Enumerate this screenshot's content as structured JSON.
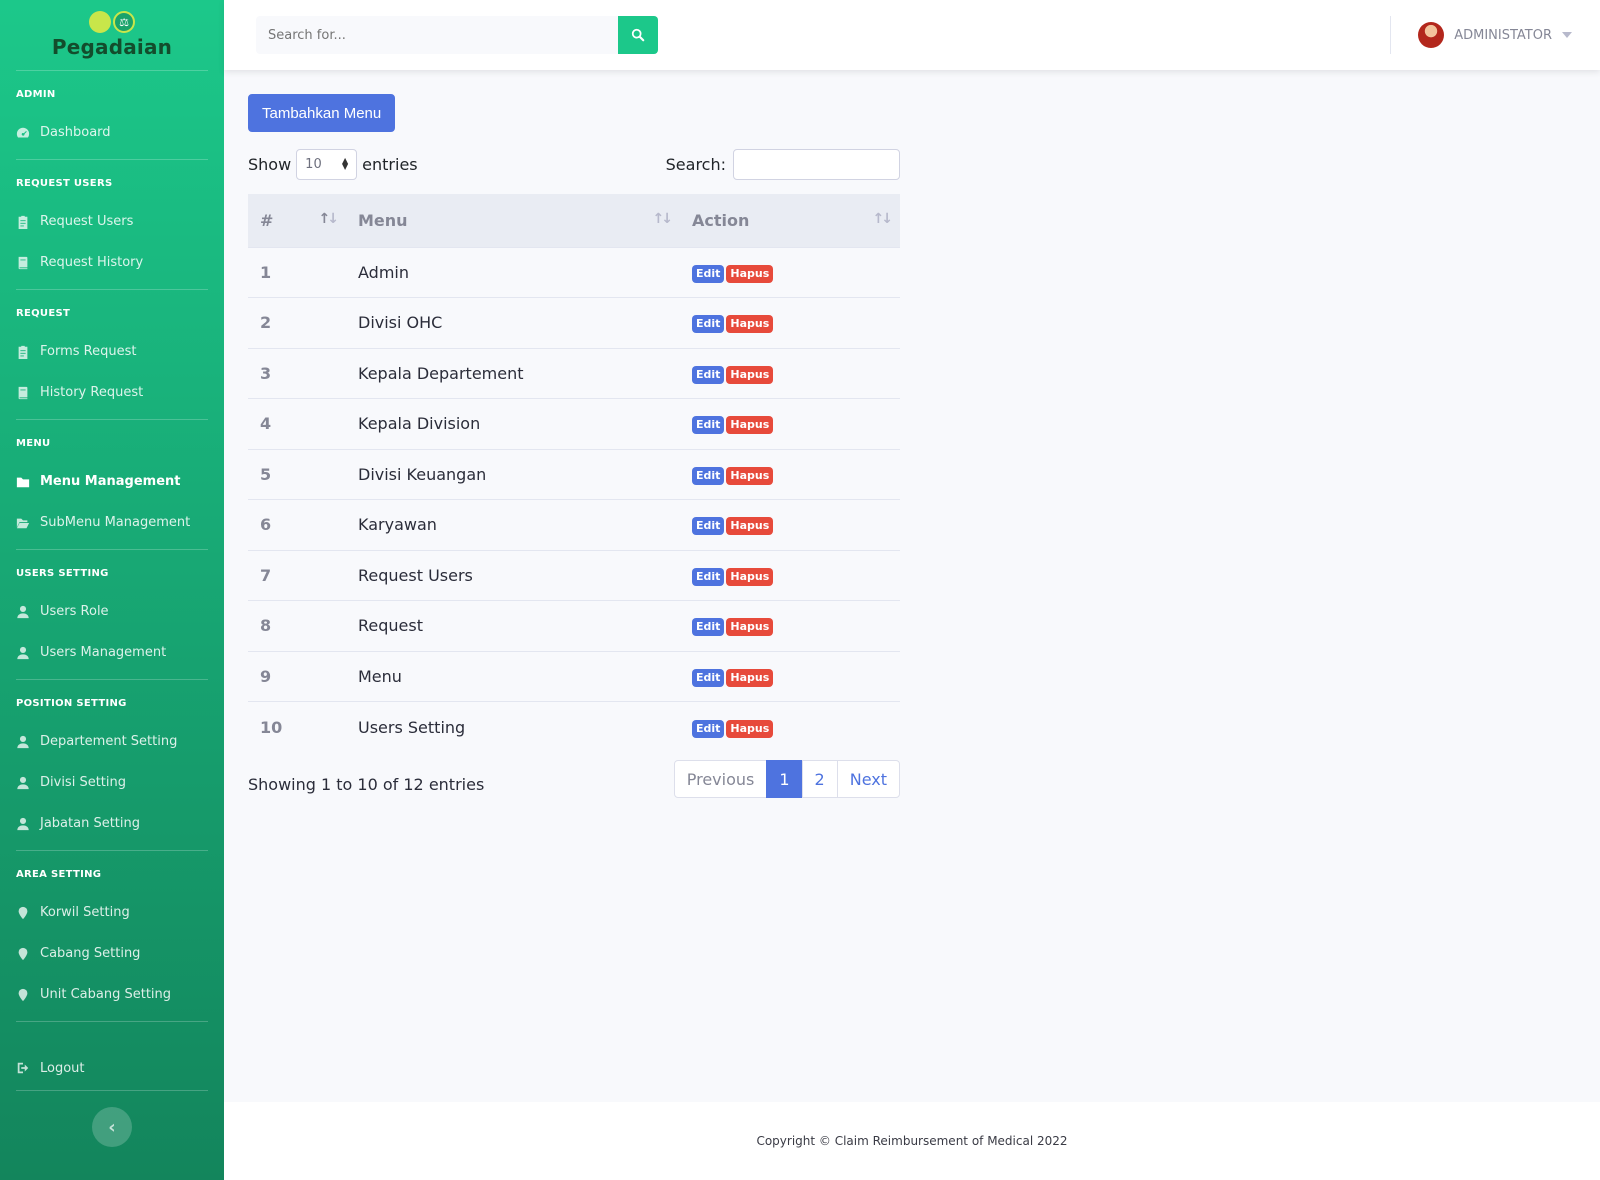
{
  "brand": {
    "name": "Pegadaian"
  },
  "sidebar": {
    "sections": [
      {
        "heading": "ADMIN",
        "items": [
          {
            "label": "Dashboard",
            "icon": "dashboard-icon"
          }
        ]
      },
      {
        "heading": "REQUEST USERS",
        "items": [
          {
            "label": "Request Users",
            "icon": "clipboard-icon"
          },
          {
            "label": "Request History",
            "icon": "book-icon"
          }
        ]
      },
      {
        "heading": "REQUEST",
        "items": [
          {
            "label": "Forms Request",
            "icon": "clipboard-icon"
          },
          {
            "label": "History Request",
            "icon": "book-icon"
          }
        ]
      },
      {
        "heading": "MENU",
        "items": [
          {
            "label": "Menu Management",
            "icon": "folder-icon",
            "active": true
          },
          {
            "label": "SubMenu Management",
            "icon": "folder-open-icon"
          }
        ]
      },
      {
        "heading": "USERS SETTING",
        "items": [
          {
            "label": "Users Role",
            "icon": "user-icon"
          },
          {
            "label": "Users Management",
            "icon": "user-icon"
          }
        ]
      },
      {
        "heading": "POSITION SETTING",
        "items": [
          {
            "label": "Departement Setting",
            "icon": "user-icon"
          },
          {
            "label": "Divisi Setting",
            "icon": "user-icon"
          },
          {
            "label": "Jabatan Setting",
            "icon": "user-icon"
          }
        ]
      },
      {
        "heading": "AREA SETTING",
        "items": [
          {
            "label": "Korwil Setting",
            "icon": "map-marker-icon"
          },
          {
            "label": "Cabang Setting",
            "icon": "map-marker-icon"
          },
          {
            "label": "Unit Cabang Setting",
            "icon": "map-marker-icon"
          }
        ]
      }
    ],
    "logout_label": "Logout",
    "toggle_glyph": "‹"
  },
  "topbar": {
    "search_placeholder": "Search for...",
    "user_name": "ADMINISTATOR"
  },
  "main": {
    "add_button": "Tambahkan Menu",
    "show_label": "Show",
    "entries_label": "entries",
    "page_length": "10",
    "search_label": "Search:",
    "columns": [
      "#",
      "Menu",
      "Action"
    ],
    "rows": [
      {
        "num": "1",
        "menu": "Admin"
      },
      {
        "num": "2",
        "menu": "Divisi OHC"
      },
      {
        "num": "3",
        "menu": "Kepala Departement"
      },
      {
        "num": "4",
        "menu": "Kepala Division"
      },
      {
        "num": "5",
        "menu": "Divisi Keuangan"
      },
      {
        "num": "6",
        "menu": "Karyawan"
      },
      {
        "num": "7",
        "menu": "Request Users"
      },
      {
        "num": "8",
        "menu": "Request"
      },
      {
        "num": "9",
        "menu": "Menu"
      },
      {
        "num": "10",
        "menu": "Users Setting"
      }
    ],
    "edit_label": "Edit",
    "delete_label": "Hapus",
    "info": "Showing 1 to 10 of 12 entries",
    "pagination": {
      "previous": "Previous",
      "pages": [
        "1",
        "2"
      ],
      "current": "1",
      "next": "Next"
    }
  },
  "footer": {
    "copyright": "Copyright © Claim Reimbursement of Medical 2022"
  },
  "colors": {
    "sidebar_top": "#1cc88a",
    "sidebar_bottom": "#13855c",
    "primary": "#4e73df",
    "danger": "#e74a3b",
    "success": "#1cc88a"
  }
}
